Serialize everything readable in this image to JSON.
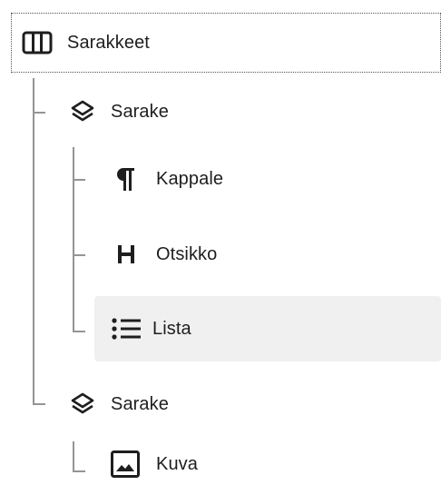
{
  "list_view": {
    "items": [
      {
        "label": "Sarakkeet",
        "icon": "columns-icon",
        "level": 0,
        "state": "focused"
      },
      {
        "label": "Sarake",
        "icon": "column-stack-icon",
        "level": 1,
        "state": "normal"
      },
      {
        "label": "Kappale",
        "icon": "paragraph-icon",
        "level": 2,
        "state": "normal"
      },
      {
        "label": "Otsikko",
        "icon": "heading-icon",
        "level": 2,
        "state": "normal"
      },
      {
        "label": "Lista",
        "icon": "list-icon",
        "level": 2,
        "state": "hover"
      },
      {
        "label": "Sarake",
        "icon": "column-stack-icon",
        "level": 1,
        "state": "normal"
      },
      {
        "label": "Kuva",
        "icon": "image-icon",
        "level": 2,
        "state": "normal"
      }
    ]
  },
  "colors": {
    "text": "#1e1e1e",
    "tree_line": "#949494",
    "hover_background": "#f0f0f0",
    "focus_outline": "#555555"
  }
}
